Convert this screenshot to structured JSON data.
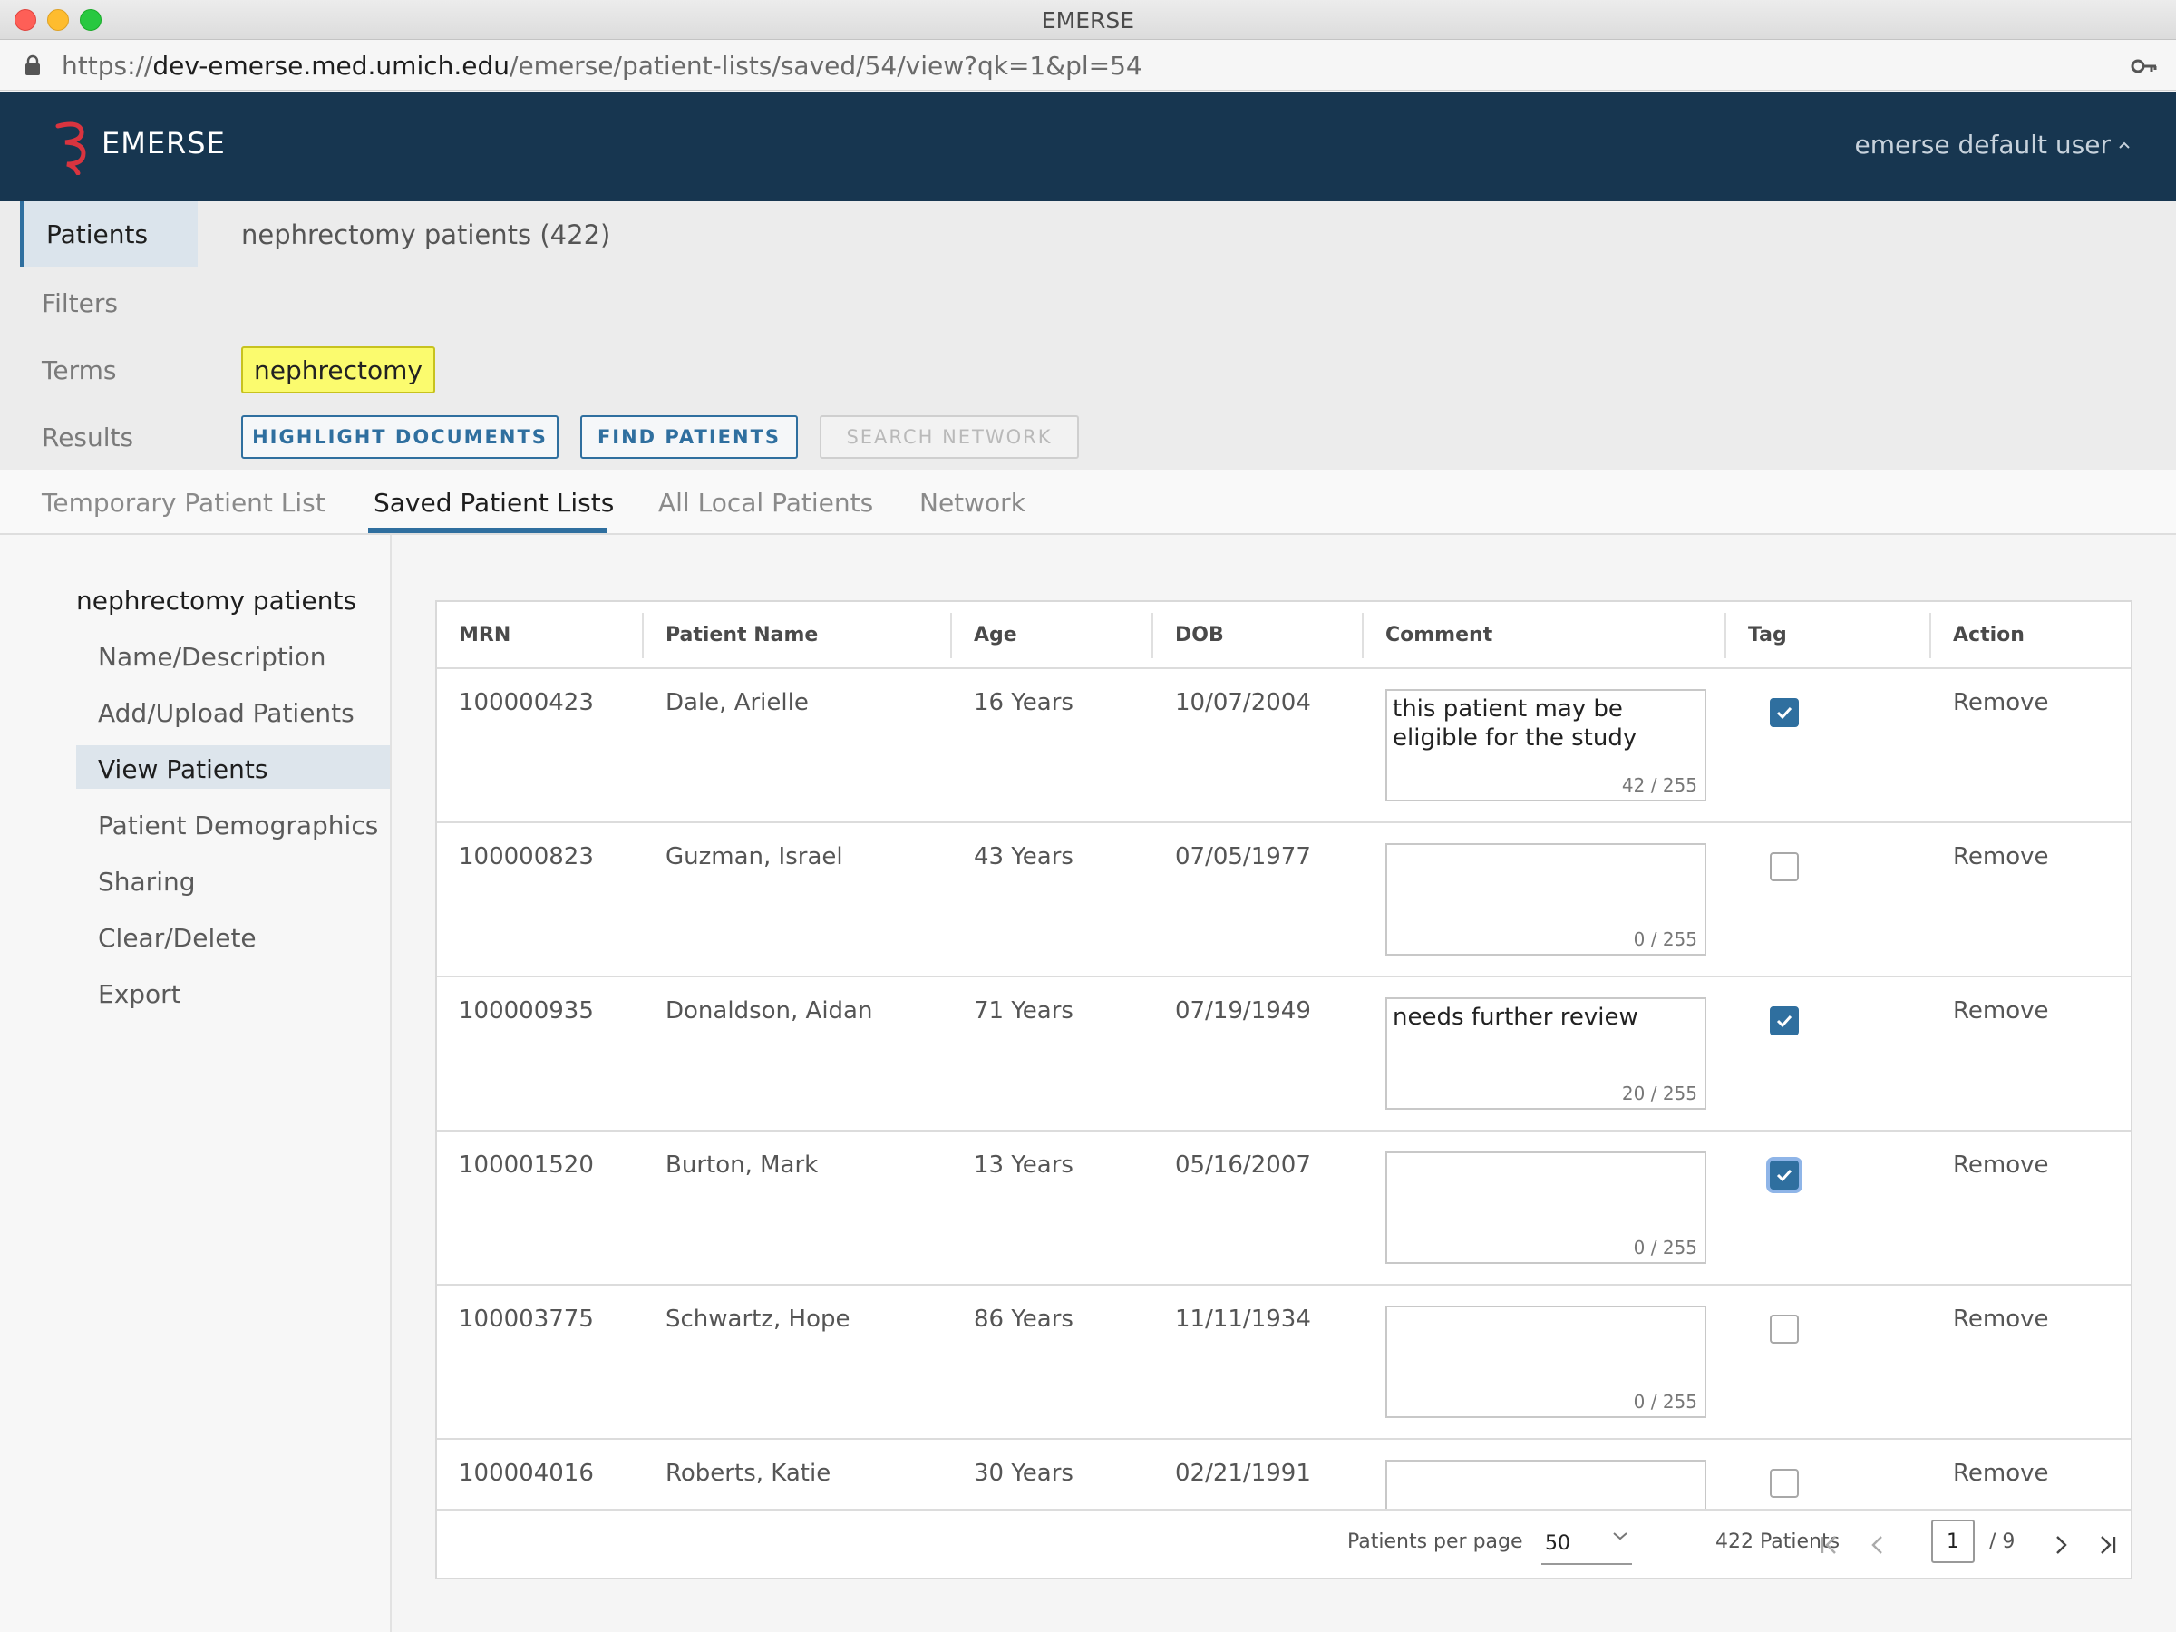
{
  "window": {
    "title": "EMERSE"
  },
  "browser": {
    "url_scheme": "https://",
    "url_host": "dev-emerse.med.umich.edu",
    "url_path": "/emerse/patient-lists/saved/54/view?qk=1&pl=54"
  },
  "header": {
    "app_name": "EMERSE",
    "user": "emerse default user",
    "brand_color": "#173650",
    "logo_color": "#d9343f"
  },
  "query": {
    "labels": {
      "patients": "Patients",
      "filters": "Filters",
      "terms": "Terms",
      "results": "Results"
    },
    "patients_title": "nephrectomy patients (422)",
    "term": "nephrectomy",
    "buttons": {
      "highlight": "HIGHLIGHT DOCUMENTS",
      "find": "FIND PATIENTS",
      "network": "SEARCH NETWORK"
    }
  },
  "tabs": [
    "Temporary Patient List",
    "Saved Patient Lists",
    "All Local Patients",
    "Network"
  ],
  "active_tab": "Saved Patient Lists",
  "sidebar": {
    "heading": "nephrectomy patients",
    "items": [
      "Name/Description",
      "Add/Upload Patients",
      "View Patients",
      "Patient Demographics",
      "Sharing",
      "Clear/Delete",
      "Export"
    ],
    "active_item": "View Patients"
  },
  "table": {
    "columns": [
      "MRN",
      "Patient Name",
      "Age",
      "DOB",
      "Comment",
      "Tag",
      "Action"
    ],
    "action_label": "Remove",
    "rows": [
      {
        "mrn": "100000423",
        "name": "Dale, Arielle",
        "age": "16 Years",
        "dob": "10/07/2004",
        "comment": "this patient may be eligible for the study",
        "count": "42 / 255",
        "tagged": true
      },
      {
        "mrn": "100000823",
        "name": "Guzman, Israel",
        "age": "43 Years",
        "dob": "07/05/1977",
        "comment": "",
        "count": "0 / 255",
        "tagged": false
      },
      {
        "mrn": "100000935",
        "name": "Donaldson, Aidan",
        "age": "71 Years",
        "dob": "07/19/1949",
        "comment": "needs further review",
        "count": "20 / 255",
        "tagged": true
      },
      {
        "mrn": "100001520",
        "name": "Burton, Mark",
        "age": "13 Years",
        "dob": "05/16/2007",
        "comment": "",
        "count": "0 / 255",
        "tagged": true
      },
      {
        "mrn": "100003775",
        "name": "Schwartz, Hope",
        "age": "86 Years",
        "dob": "11/11/1934",
        "comment": "",
        "count": "0 / 255",
        "tagged": false
      },
      {
        "mrn": "100004016",
        "name": "Roberts, Katie",
        "age": "30 Years",
        "dob": "02/21/1991",
        "comment": "",
        "count": "",
        "tagged": false
      }
    ]
  },
  "pagination": {
    "per_page_label": "Patients per page",
    "per_page": "50",
    "total": "422 Patients",
    "page": "1",
    "pages": "/ 9"
  },
  "icons": {
    "lock": "lock-icon",
    "key": "key-icon",
    "caret": "caret-up-icon",
    "check": "check-icon",
    "chevron": "chevron-down-icon",
    "first": "first-page-icon",
    "prev": "prev-page-icon",
    "next": "next-page-icon",
    "last": "last-page-icon"
  }
}
